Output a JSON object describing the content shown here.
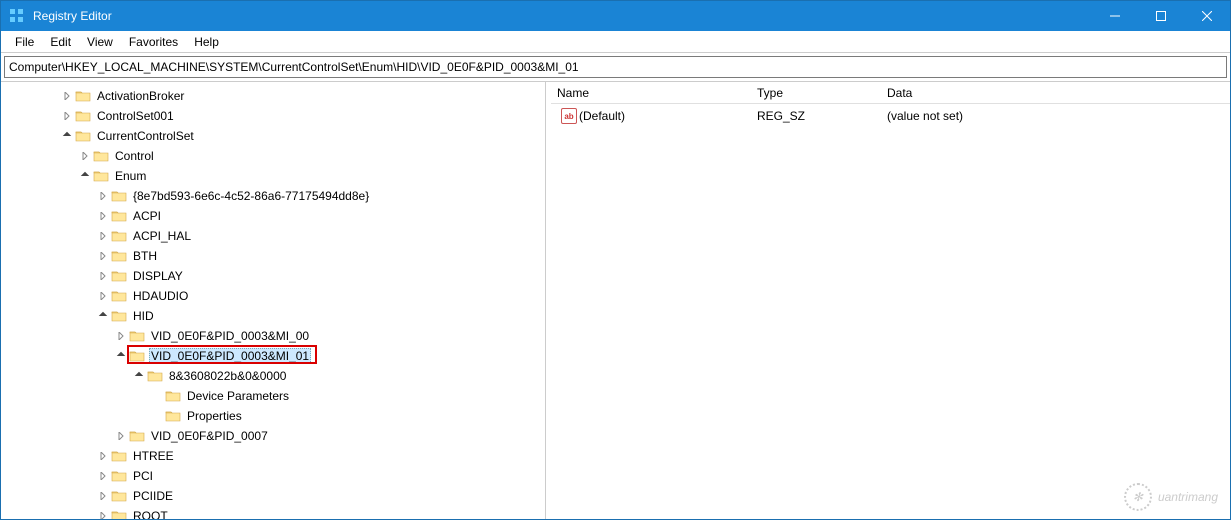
{
  "titlebar": {
    "title": "Registry Editor"
  },
  "menubar": {
    "items": [
      "File",
      "Edit",
      "View",
      "Favorites",
      "Help"
    ]
  },
  "address": "Computer\\HKEY_LOCAL_MACHINE\\SYSTEM\\CurrentControlSet\\Enum\\HID\\VID_0E0F&PID_0003&MI_01",
  "list": {
    "headers": {
      "name": "Name",
      "type": "Type",
      "data": "Data"
    },
    "rows": [
      {
        "name": "(Default)",
        "type": "REG_SZ",
        "data": "(value not set)"
      }
    ]
  },
  "tree": {
    "items": [
      {
        "indent": 3,
        "arrow": "collapsed",
        "label": "ActivationBroker"
      },
      {
        "indent": 3,
        "arrow": "collapsed",
        "label": "ControlSet001"
      },
      {
        "indent": 3,
        "arrow": "expanded",
        "label": "CurrentControlSet"
      },
      {
        "indent": 4,
        "arrow": "collapsed",
        "label": "Control"
      },
      {
        "indent": 4,
        "arrow": "expanded",
        "label": "Enum"
      },
      {
        "indent": 5,
        "arrow": "collapsed",
        "label": "{8e7bd593-6e6c-4c52-86a6-77175494dd8e}"
      },
      {
        "indent": 5,
        "arrow": "collapsed",
        "label": "ACPI"
      },
      {
        "indent": 5,
        "arrow": "collapsed",
        "label": "ACPI_HAL"
      },
      {
        "indent": 5,
        "arrow": "collapsed",
        "label": "BTH"
      },
      {
        "indent": 5,
        "arrow": "collapsed",
        "label": "DISPLAY"
      },
      {
        "indent": 5,
        "arrow": "collapsed",
        "label": "HDAUDIO"
      },
      {
        "indent": 5,
        "arrow": "expanded",
        "label": "HID"
      },
      {
        "indent": 6,
        "arrow": "collapsed",
        "label": "VID_0E0F&PID_0003&MI_00"
      },
      {
        "indent": 6,
        "arrow": "expanded",
        "label": "VID_0E0F&PID_0003&MI_01",
        "selected": true,
        "highlighted": true
      },
      {
        "indent": 7,
        "arrow": "expanded",
        "label": "8&3608022b&0&0000"
      },
      {
        "indent": 8,
        "arrow": "blank",
        "label": "Device Parameters"
      },
      {
        "indent": 8,
        "arrow": "blank",
        "label": "Properties"
      },
      {
        "indent": 6,
        "arrow": "collapsed",
        "label": "VID_0E0F&PID_0007"
      },
      {
        "indent": 5,
        "arrow": "collapsed",
        "label": "HTREE"
      },
      {
        "indent": 5,
        "arrow": "collapsed",
        "label": "PCI"
      },
      {
        "indent": 5,
        "arrow": "collapsed",
        "label": "PCIIDE"
      },
      {
        "indent": 5,
        "arrow": "collapsed",
        "label": "ROOT"
      }
    ]
  },
  "watermark": "uantrimang"
}
